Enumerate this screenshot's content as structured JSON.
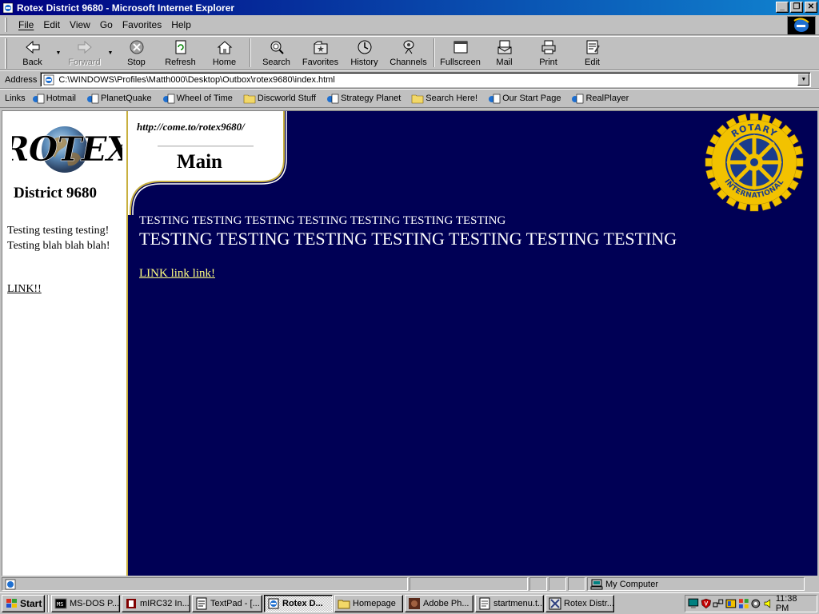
{
  "window": {
    "title": "Rotex District 9680 - Microsoft Internet Explorer",
    "min": "_",
    "max": "❐",
    "close": "✕"
  },
  "menu": {
    "items": [
      "File",
      "Edit",
      "View",
      "Go",
      "Favorites",
      "Help"
    ]
  },
  "toolbar": {
    "back": "Back",
    "forward": "Forward",
    "stop": "Stop",
    "refresh": "Refresh",
    "home": "Home",
    "search": "Search",
    "favorites": "Favorites",
    "history": "History",
    "channels": "Channels",
    "fullscreen": "Fullscreen",
    "mail": "Mail",
    "print": "Print",
    "edit": "Edit"
  },
  "address": {
    "label": "Address",
    "value": "C:\\WINDOWS\\Profiles\\Matth000\\Desktop\\Outbox\\rotex9680\\index.html"
  },
  "links": {
    "label": "Links",
    "items": [
      "Hotmail",
      "PlanetQuake",
      "Wheel of Time",
      "Discworld Stuff",
      "Strategy Planet",
      "Search Here!",
      "Our Start Page",
      "RealPlayer"
    ]
  },
  "page": {
    "logo_text": "ROTEX",
    "district": "District 9680",
    "left_text": "Testing testing testing! Testing blah blah blah!",
    "left_link": "LINK!!",
    "url": "http://come.to/rotex9680/",
    "heading": "Main",
    "emblem_text_top": "ROTARY",
    "emblem_text_bottom": "INTERNATIONAL",
    "testing_small": "TESTING TESTING TESTING TESTING TESTING TESTING TESTING",
    "testing_large": "TESTING TESTING TESTING TESTING TESTING TESTING TESTING",
    "main_link": "LINK link link!",
    "bg_color": "#000055",
    "link_color": "#ffff80",
    "accent_color": "#c8b040"
  },
  "status": {
    "zone": "My Computer"
  },
  "taskbar": {
    "start": "Start",
    "tasks": [
      "MS-DOS P...",
      "mIRC32 In...",
      "TextPad - [...",
      "Rotex D...",
      "Homepage",
      "Adobe Ph...",
      "startmenu.t...",
      "Rotex Distr..."
    ],
    "active_index": 3,
    "clock": "11:38 PM"
  }
}
